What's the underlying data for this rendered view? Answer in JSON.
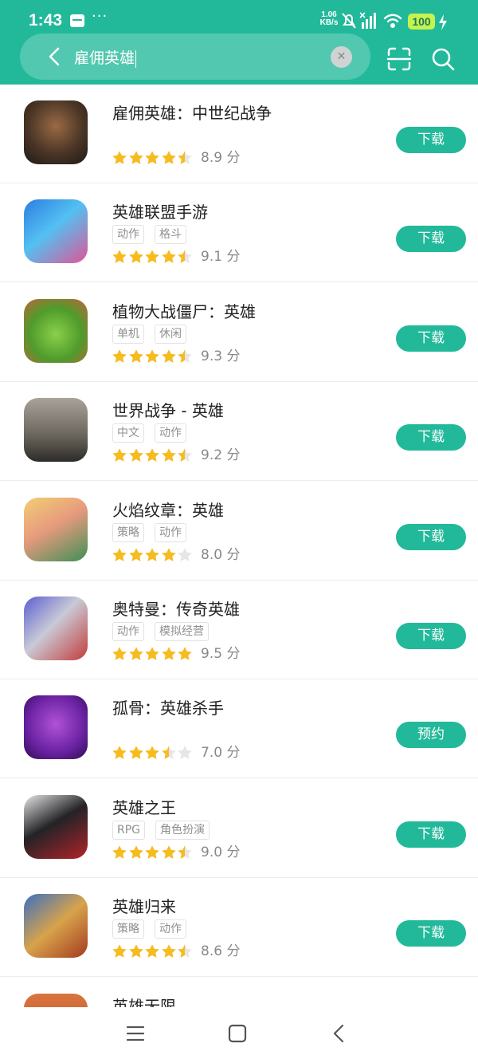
{
  "status": {
    "time": "1:43",
    "dots": "···",
    "net_speed_value": "1.06",
    "net_speed_unit": "KB/s",
    "battery": "100"
  },
  "search": {
    "query": "雇佣英雄"
  },
  "colors": {
    "accent": "#22b99a",
    "star": "#f6bb1f",
    "star_empty": "#e6e6e6"
  },
  "apps": [
    {
      "name": "雇佣英雄：中世纪战争",
      "tags": [],
      "rating": 4.5,
      "score": "8.9 分",
      "button": "下载"
    },
    {
      "name": "英雄联盟手游",
      "tags": [
        "动作",
        "格斗"
      ],
      "rating": 4.5,
      "score": "9.1 分",
      "button": "下载"
    },
    {
      "name": "植物大战僵尸：英雄",
      "tags": [
        "单机",
        "休闲"
      ],
      "rating": 4.5,
      "score": "9.3 分",
      "button": "下载"
    },
    {
      "name": "世界战争 - 英雄",
      "tags": [
        "中文",
        "动作"
      ],
      "rating": 4.5,
      "score": "9.2 分",
      "button": "下载"
    },
    {
      "name": "火焰纹章：英雄",
      "tags": [
        "策略",
        "动作"
      ],
      "rating": 4,
      "score": "8.0 分",
      "button": "下载"
    },
    {
      "name": "奥特曼：传奇英雄",
      "tags": [
        "动作",
        "模拟经营"
      ],
      "rating": 5,
      "score": "9.5 分",
      "button": "下载"
    },
    {
      "name": "孤骨：英雄杀手",
      "tags": [],
      "rating": 3.5,
      "score": "7.0 分",
      "button": "预约"
    },
    {
      "name": "英雄之王",
      "tags": [
        "RPG",
        "角色扮演"
      ],
      "rating": 4.5,
      "score": "9.0 分",
      "button": "下载"
    },
    {
      "name": "英雄归来",
      "tags": [
        "策略",
        "动作"
      ],
      "rating": 4.5,
      "score": "8.6 分",
      "button": "下载"
    },
    {
      "name": "英雄无限",
      "tags": [],
      "rating": 0,
      "score": "",
      "button": ""
    }
  ],
  "icons": {
    "back": "back-arrow-icon",
    "clear": "clear-icon",
    "scan": "scan-icon",
    "search": "search-icon",
    "nav": [
      "menu-icon",
      "home-icon",
      "back-icon"
    ]
  }
}
